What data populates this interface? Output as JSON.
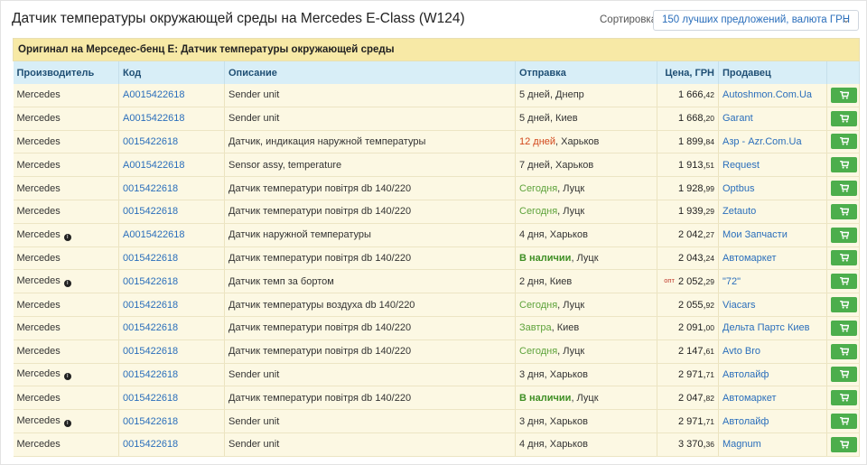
{
  "page_title": "Датчик температуры окружающей среды на Mercedes E-Class (W124)",
  "sort": {
    "label": "Сортировка:",
    "value": "150 лучших предложений, валюта ГРН"
  },
  "group_title": "Оригинал на Мерседес-бенц Е: Датчик температуры окружающей среды",
  "columns": [
    "Производитель",
    "Код",
    "Описание",
    "Отправка",
    "Цена, ГРН",
    "Продавец"
  ],
  "icons": {
    "cart": "shopping-cart-icon",
    "info": "info-circle-icon",
    "sort_chevron": "chevron-down-icon"
  },
  "colors": {
    "group_bg": "#f7e9a6",
    "header_bg": "#d8eef7",
    "row_bg": "#fcf8e3",
    "link": "#2a6ebb",
    "fast_ship": "#5ea33b",
    "slow_ship": "#d2471b",
    "cart_button": "#4cae4c"
  },
  "rows": [
    {
      "maker": "Mercedes",
      "info": false,
      "code": "A0015422618",
      "desc": "Sender unit",
      "ship_day": "5 дней",
      "ship_city": ", Днепр",
      "ship_style": "",
      "price_main": "1 666,",
      "price_kop": "42",
      "opt": "",
      "seller": "Autoshmon.Com.Ua"
    },
    {
      "maker": "Mercedes",
      "info": false,
      "code": "A0015422618",
      "desc": "Sender unit",
      "ship_day": "5 дней",
      "ship_city": ", Киев",
      "ship_style": "",
      "price_main": "1 668,",
      "price_kop": "20",
      "opt": "",
      "seller": "Garant"
    },
    {
      "maker": "Mercedes",
      "info": false,
      "code": "0015422618",
      "desc": "Датчик, индикация наружной температуры",
      "ship_day": "12 дней",
      "ship_city": ", Харьков",
      "ship_style": "slow",
      "price_main": "1 899,",
      "price_kop": "84",
      "opt": "",
      "seller": "Азр - Azr.Com.Ua"
    },
    {
      "maker": "Mercedes",
      "info": false,
      "code": "A0015422618",
      "desc": "Sensor assy, temperature",
      "ship_day": "7 дней",
      "ship_city": ", Харьков",
      "ship_style": "",
      "price_main": "1 913,",
      "price_kop": "51",
      "opt": "",
      "seller": "Request"
    },
    {
      "maker": "Mercedes",
      "info": false,
      "code": "0015422618",
      "desc": "Датчик температури повітря db 140/220",
      "ship_day": "Сегодня",
      "ship_city": ", Луцк",
      "ship_style": "fast",
      "price_main": "1 928,",
      "price_kop": "99",
      "opt": "",
      "seller": "Optbus"
    },
    {
      "maker": "Mercedes",
      "info": false,
      "code": "0015422618",
      "desc": "Датчик температури повітря db 140/220",
      "ship_day": "Сегодня",
      "ship_city": ", Луцк",
      "ship_style": "fast",
      "price_main": "1 939,",
      "price_kop": "29",
      "opt": "",
      "seller": "Zetauto"
    },
    {
      "maker": "Mercedes",
      "info": true,
      "code": "A0015422618",
      "desc": "Датчик наружной температуры",
      "ship_day": "4 дня",
      "ship_city": ", Харьков",
      "ship_style": "",
      "price_main": "2 042,",
      "price_kop": "27",
      "opt": "",
      "seller": "Мои Запчасти"
    },
    {
      "maker": "Mercedes",
      "info": false,
      "code": "0015422618",
      "desc": "Датчик температури повітря db 140/220",
      "ship_day": "В наличии",
      "ship_city": ", Луцк",
      "ship_style": "stock",
      "price_main": "2 043,",
      "price_kop": "24",
      "opt": "",
      "seller": "Автомаркет"
    },
    {
      "maker": "Mercedes",
      "info": true,
      "code": "0015422618",
      "desc": "Датчик темп за бортом",
      "ship_day": "2 дня",
      "ship_city": ", Киев",
      "ship_style": "",
      "price_main": "2 052,",
      "price_kop": "29",
      "opt": "опт",
      "seller": "\"72\""
    },
    {
      "maker": "Mercedes",
      "info": false,
      "code": "0015422618",
      "desc": "Датчик температуры воздуха db 140/220",
      "ship_day": "Сегодня",
      "ship_city": ", Луцк",
      "ship_style": "fast",
      "price_main": "2 055,",
      "price_kop": "92",
      "opt": "",
      "seller": "Viacars"
    },
    {
      "maker": "Mercedes",
      "info": false,
      "code": "0015422618",
      "desc": "Датчик температури повітря db 140/220",
      "ship_day": "Завтра",
      "ship_city": ", Киев",
      "ship_style": "fast",
      "price_main": "2 091,",
      "price_kop": "00",
      "opt": "",
      "seller": "Дельта Партс Киев"
    },
    {
      "maker": "Mercedes",
      "info": false,
      "code": "0015422618",
      "desc": "Датчик температури повітря db 140/220",
      "ship_day": "Сегодня",
      "ship_city": ", Луцк",
      "ship_style": "fast",
      "price_main": "2 147,",
      "price_kop": "61",
      "opt": "",
      "seller": "Avto Bro"
    },
    {
      "maker": "Mercedes",
      "info": true,
      "code": "0015422618",
      "desc": "Sender unit",
      "ship_day": "3 дня",
      "ship_city": ", Харьков",
      "ship_style": "",
      "price_main": "2 971,",
      "price_kop": "71",
      "opt": "",
      "seller": "Автолайф"
    },
    {
      "maker": "Mercedes",
      "info": false,
      "code": "0015422618",
      "desc": "Датчик температури повітря db 140/220",
      "ship_day": "В наличии",
      "ship_city": ", Луцк",
      "ship_style": "stock",
      "price_main": "2 047,",
      "price_kop": "82",
      "opt": "",
      "seller": "Автомаркет"
    },
    {
      "maker": "Mercedes",
      "info": true,
      "code": "0015422618",
      "desc": "Sender unit",
      "ship_day": "3 дня",
      "ship_city": ", Харьков",
      "ship_style": "",
      "price_main": "2 971,",
      "price_kop": "71",
      "opt": "",
      "seller": "Автолайф"
    },
    {
      "maker": "Mercedes",
      "info": false,
      "code": "0015422618",
      "desc": "Sender unit",
      "ship_day": "4 дня",
      "ship_city": ", Харьков",
      "ship_style": "",
      "price_main": "3 370,",
      "price_kop": "36",
      "opt": "",
      "seller": "Magnum"
    }
  ]
}
